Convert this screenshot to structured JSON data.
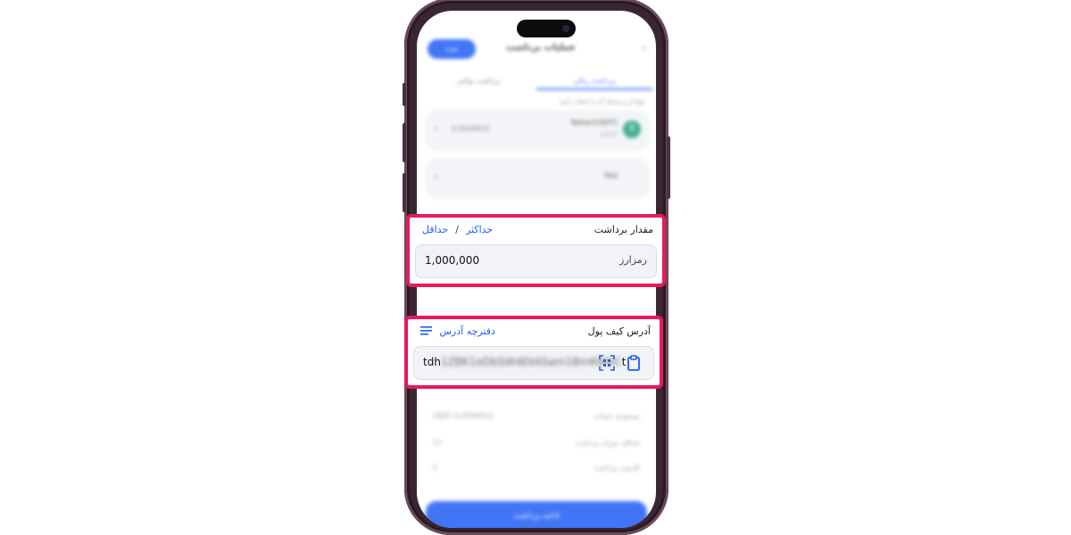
{
  "background": {
    "app_bar_button": "ثبت",
    "title": "عملیات برداشت",
    "tab_active": "برداشت ریالی",
    "tab_idle": "برداشت توکنی",
    "hint": "نوع ارز و شبکه آن را انتخاب کنید",
    "coin": {
      "name": "Tether(USDT)",
      "symbol": "USDT",
      "balance": "0.0544022"
    },
    "network": "TRX",
    "summary": [
      {
        "label": "موجودی حساب",
        "value": "USDT 0.0544022"
      },
      {
        "label": "حداقل میزان برداشت",
        "value": "11"
      },
      {
        "label": "کارمزد برداشت",
        "value": "5"
      }
    ],
    "cta": "ادامه برداشت"
  },
  "amount": {
    "label": "مقدار برداشت",
    "min_link": "حداقل",
    "separator": "/",
    "max_link": "حداکثر",
    "value": "1,000,000",
    "unit": "رمزارز"
  },
  "wallet": {
    "label": "آدرس کیف پول",
    "book_link": "دفترچه آدرس",
    "address_prefix": "tdh",
    "address_masked": "1ZBK1eDbSW4Ek6Sam1BmKW6C",
    "address_suffix": "t"
  },
  "colors": {
    "accent": "#1f5df5",
    "highlight": "#e8195a"
  }
}
